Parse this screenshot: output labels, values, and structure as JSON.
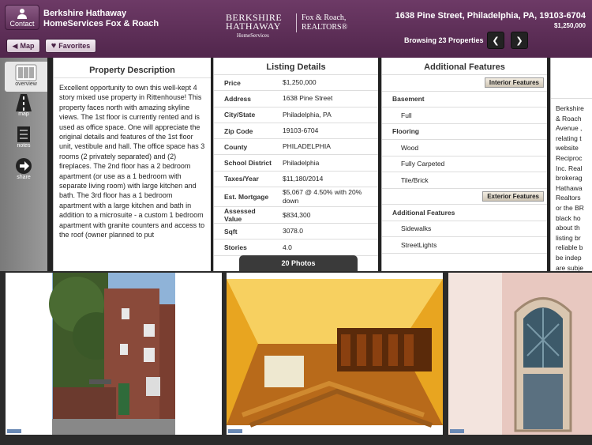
{
  "header": {
    "contact_label": "Contact",
    "agent_line1": "Berkshire Hathaway",
    "agent_line2": "HomeServices Fox & Roach",
    "logo_line1": "BERKSHIRE",
    "logo_line2": "HATHAWAY",
    "logo_line3": "HomeServices",
    "logo_right1": "Fox & Roach,",
    "logo_right2": "REALTORS®",
    "address": "1638 Pine Street, Philadelphia, PA, 19103-6704",
    "price": "$1,250,000",
    "map_label": "Map",
    "favorites_label": "Favorites",
    "browsing": "Browsing 23 Properties",
    "prev_icon": "chevron-left-icon",
    "next_icon": "chevron-right-icon",
    "brand_color": "#5e2d58"
  },
  "sidebar": {
    "items": [
      {
        "label": "overview",
        "icon": "overview-icon"
      },
      {
        "label": "map",
        "icon": "road-icon"
      },
      {
        "label": "notes",
        "icon": "notes-icon"
      },
      {
        "label": "share",
        "icon": "share-arrow-icon"
      }
    ]
  },
  "description": {
    "title": "Property Description",
    "text": "Excellent opportunity to own this well-kept 4 story mixed use property in Rittenhouse! This property faces north with amazing skyline views. The 1st floor is currently rented and is used as office space. One will appreciate the original details and features of the 1st floor unit, vestibule and hall. The office space has 3 rooms (2 privately separated) and (2) fireplaces. The 2nd floor has a 2 bedroom apartment (or use as a 1 bedroom with separate living room) with large kitchen and bath. The 3rd floor has a 1 bedroom apartment with a large kitchen and bath in addition to a microsuite - a custom 1 bedroom apartment with granite counters and access to the roof (owner planned to put"
  },
  "listing": {
    "title": "Listing Details",
    "rows": [
      {
        "k": "Price",
        "v": "$1,250,000"
      },
      {
        "k": "Address",
        "v": "1638 Pine Street"
      },
      {
        "k": "City/State",
        "v": "Philadelphia, PA"
      },
      {
        "k": "Zip Code",
        "v": "19103-6704"
      },
      {
        "k": "County",
        "v": "PHILADELPHIA"
      },
      {
        "k": "School District",
        "v": "Philadelphia"
      },
      {
        "k": "Taxes/Year",
        "v": "$11,180/2014"
      },
      {
        "k": "Est. Mortgage",
        "v": "$5,067 @ 4.50% with 20% down"
      },
      {
        "k": "Assessed Value",
        "v": "$834,300"
      },
      {
        "k": "Sqft",
        "v": "3078.0"
      },
      {
        "k": "Stories",
        "v": "4.0"
      }
    ]
  },
  "features": {
    "title": "Additional Features",
    "interior_tag": "Interior Features",
    "exterior_tag": "Exterior Features",
    "basement_head": "Basement",
    "basement_items": [
      "Full"
    ],
    "flooring_head": "Flooring",
    "flooring_items": [
      "Wood",
      "Fully Carpeted",
      "Tile/Brick"
    ],
    "additional_head": "Additional Features",
    "additional_items": [
      "Sidewalks",
      "StreetLights"
    ]
  },
  "disclaimer": {
    "text": "Berkshire\n& Roach\nAvenue ,\nrelating t\nwebsite\nReciproc\nInc. Real\nbrokerag\nHathawa\nRealtors\nor the BR\nblack ho\nabout th\nlisting br\nreliable b\nbe indep\nare subje"
  },
  "photos": {
    "tab_label": "20 Photos"
  }
}
